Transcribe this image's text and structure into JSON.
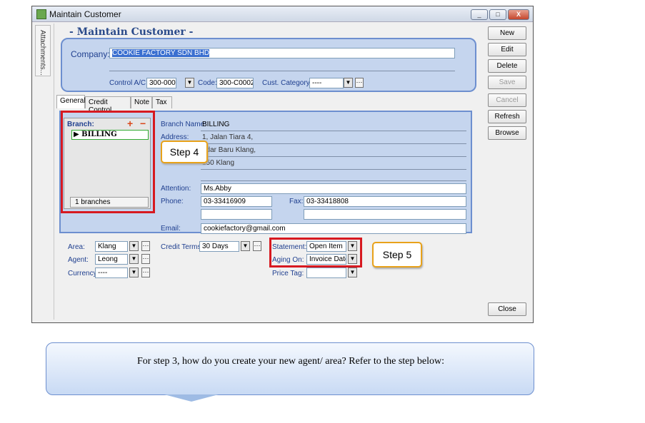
{
  "window": {
    "title": "Maintain Customer",
    "controls": [
      "_",
      "□",
      "X"
    ]
  },
  "attachments_tab": "Attachments...",
  "header": {
    "title": "- Maintain Customer -",
    "company_label": "Company:",
    "company_value": "COOKIE FACTORY SDN BHD",
    "control_label": "Control A/C:",
    "control_value": "300-000",
    "code_label": "Code:",
    "code_value": "300-C0002",
    "category_label": "Cust. Category:",
    "category_value": "----"
  },
  "tabs": [
    "General",
    "Credit Control",
    "Note",
    "Tax"
  ],
  "branch": {
    "title": "Branch:",
    "selected": "BILLING",
    "count": "1 branches",
    "name_label": "Branch Name:",
    "name_value": "BILLING",
    "address_label": "Address:",
    "address_lines": [
      "1, Jalan Tiara 4,",
      "ndar Baru Klang,",
      "150 Klang"
    ],
    "attention_label": "Attention:",
    "attention_value": "Ms.Abby",
    "phone_label": "Phone:",
    "phone_value": "03-33416909",
    "fax_label": "Fax:",
    "fax_value": "03-33418808",
    "email_label": "Email:",
    "email_value": "cookiefactory@gmail.com"
  },
  "bottom": {
    "area_label": "Area:",
    "area_value": "Klang",
    "agent_label": "Agent:",
    "agent_value": "Leong",
    "currency_label": "Currency:",
    "currency_value": "----",
    "terms_label": "Credit Terms:",
    "terms_value": "30 Days",
    "statement_label": "Statement:",
    "statement_value": "Open Item",
    "aging_label": "Aging On:",
    "aging_value": "Invoice Date",
    "pricetag_label": "Price Tag:"
  },
  "steps": {
    "step4": "Step 4",
    "step5": "Step 5"
  },
  "buttons": {
    "new": "New",
    "edit": "Edit",
    "delete": "Delete",
    "save": "Save",
    "cancel": "Cancel",
    "refresh": "Refresh",
    "browse": "Browse",
    "close": "Close"
  },
  "callout": "For step 3, how do you create your new agent/ area? Refer to the step below:",
  "colors": {
    "panel_bg": "#c5d5ee",
    "panel_border": "#6d8fcf",
    "highlight_red": "#d71920",
    "step_border": "#e8a21a"
  }
}
